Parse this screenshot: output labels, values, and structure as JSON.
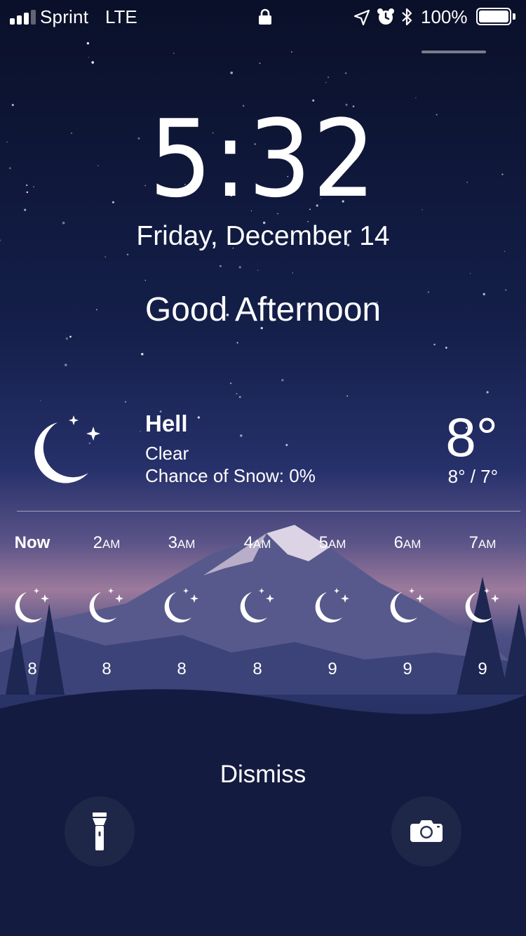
{
  "status_bar": {
    "carrier": "Sprint",
    "network": "LTE",
    "battery_percent": "100%",
    "battery_level": 1.0,
    "signal_bars": 4,
    "signal_bars_active": 3,
    "icons": [
      "lock-icon",
      "location-arrow-icon",
      "alarm-clock-icon",
      "bluetooth-icon",
      "battery-icon"
    ]
  },
  "lock_screen": {
    "time": "5:32",
    "date": "Friday, December 14",
    "greeting": "Good Afternoon"
  },
  "weather": {
    "location": "Hell",
    "condition": "Clear",
    "chance_text": "Chance of Snow: 0%",
    "temperature": "8°",
    "high_low": "8° / 7°",
    "icon": "moon-stars-icon",
    "hourly": [
      {
        "time": "Now",
        "suffix": "",
        "temp": "8",
        "icon": "moon-stars-icon"
      },
      {
        "time": "2",
        "suffix": "AM",
        "temp": "8",
        "icon": "moon-stars-icon"
      },
      {
        "time": "3",
        "suffix": "AM",
        "temp": "8",
        "icon": "moon-stars-icon"
      },
      {
        "time": "4",
        "suffix": "AM",
        "temp": "8",
        "icon": "moon-stars-icon"
      },
      {
        "time": "5",
        "suffix": "AM",
        "temp": "9",
        "icon": "moon-stars-icon"
      },
      {
        "time": "6",
        "suffix": "AM",
        "temp": "9",
        "icon": "moon-stars-icon"
      },
      {
        "time": "7",
        "suffix": "AM",
        "temp": "9",
        "icon": "moon-stars-icon"
      }
    ]
  },
  "actions": {
    "dismiss": "Dismiss",
    "left_button_icon": "flashlight-icon",
    "right_button_icon": "camera-icon"
  },
  "colors": {
    "sky_top": "#0b1230",
    "sky_mid": "#1c2a5c",
    "horizon": "#a47da0",
    "mountain": "#6a6c9c",
    "foreground": "#161d44"
  }
}
